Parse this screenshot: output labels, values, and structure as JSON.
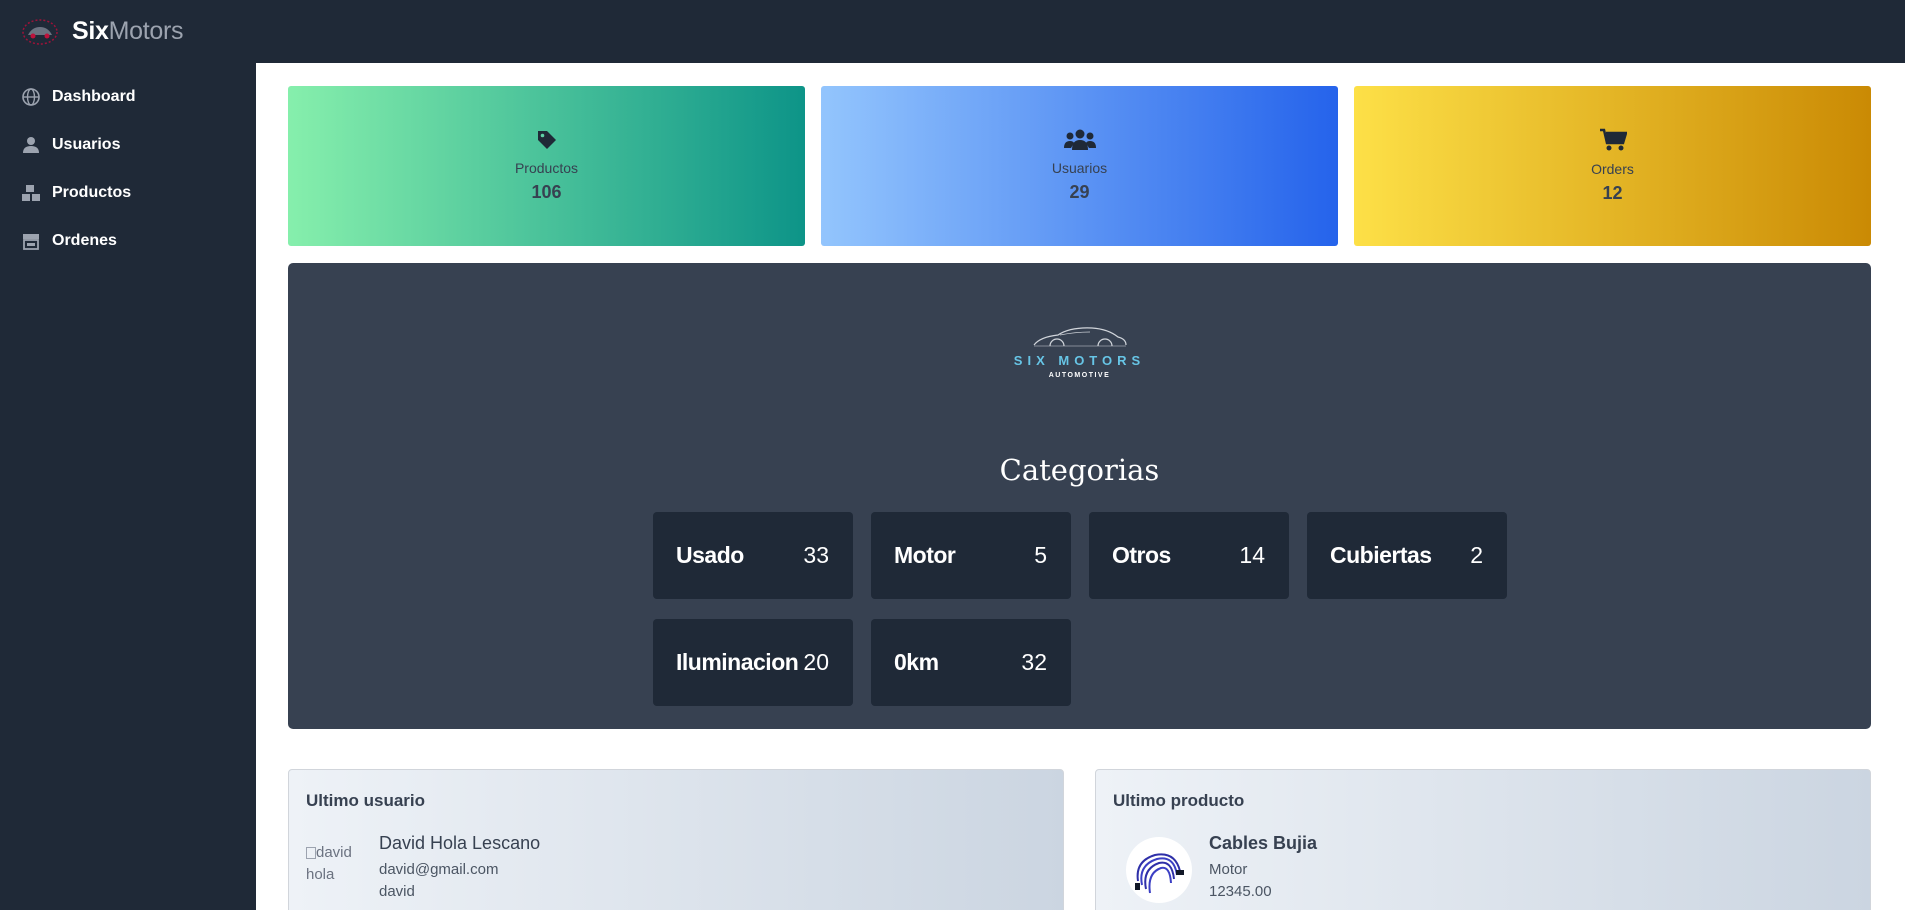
{
  "brand": {
    "part1": "Six",
    "part2": "Motors"
  },
  "sidebar": {
    "items": [
      {
        "label": "Dashboard",
        "icon": "globe-icon"
      },
      {
        "label": "Usuarios",
        "icon": "user-icon"
      },
      {
        "label": "Productos",
        "icon": "boxes-icon"
      },
      {
        "label": "Ordenes",
        "icon": "store-icon"
      }
    ]
  },
  "stats": [
    {
      "label": "Productos",
      "value": "106",
      "icon": "tag-icon"
    },
    {
      "label": "Usuarios",
      "value": "29",
      "icon": "users-icon"
    },
    {
      "label": "Orders",
      "value": "12",
      "icon": "cart-icon"
    }
  ],
  "panel": {
    "logo_line1": "SIX MOTORS",
    "logo_line2": "AUTOMOTIVE",
    "title": "Categorias",
    "categories": [
      {
        "name": "Usado",
        "count": "33"
      },
      {
        "name": "Motor",
        "count": "5"
      },
      {
        "name": "Otros",
        "count": "14"
      },
      {
        "name": "Cubiertas",
        "count": "2"
      },
      {
        "name": "Iluminacion",
        "count": "20"
      },
      {
        "name": "0km",
        "count": "32"
      }
    ]
  },
  "last_user": {
    "title": "Ultimo usuario",
    "avatar_alt": "david hola",
    "name": "David Hola Lescano",
    "email": "david@gmail.com",
    "username": "david"
  },
  "last_product": {
    "title": "Ultimo producto",
    "name": "Cables Bujia",
    "category": "Motor",
    "price": "12345.00"
  },
  "colors": {
    "sidebar_bg": "#1f2937",
    "panel_bg": "#374151",
    "accent_logo": "#67c5e6"
  }
}
